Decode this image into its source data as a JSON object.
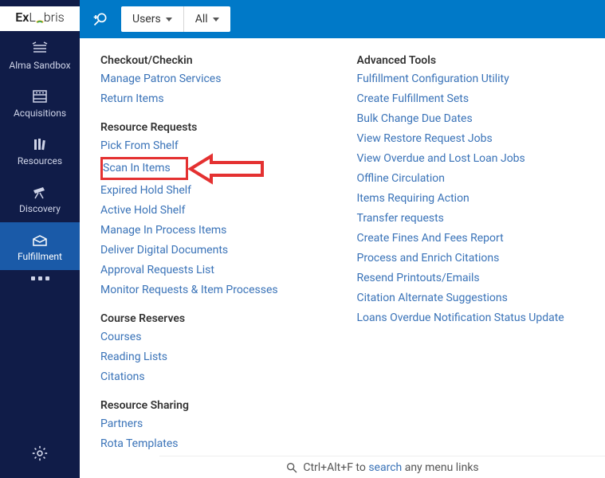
{
  "brand": {
    "name": "ExLibris"
  },
  "topbar": {
    "scope1": "Users",
    "scope2": "All"
  },
  "nav": {
    "items": [
      {
        "label": "Alma Sandbox"
      },
      {
        "label": "Acquisitions"
      },
      {
        "label": "Resources"
      },
      {
        "label": "Discovery"
      },
      {
        "label": "Fulfillment"
      }
    ]
  },
  "menu": {
    "left": [
      {
        "header": "Checkout/Checkin",
        "links": [
          "Manage Patron Services",
          "Return Items"
        ]
      },
      {
        "header": "Resource Requests",
        "links": [
          "Pick From Shelf",
          "Scan In Items",
          "Expired Hold Shelf",
          "Active Hold Shelf",
          "Manage In Process Items",
          "Deliver Digital Documents",
          "Approval Requests List",
          "Monitor Requests & Item Processes"
        ]
      },
      {
        "header": "Course Reserves",
        "links": [
          "Courses",
          "Reading Lists",
          "Citations"
        ]
      },
      {
        "header": "Resource Sharing",
        "links": [
          "Partners",
          "Rota Templates"
        ]
      }
    ],
    "right": [
      {
        "header": "Advanced Tools",
        "links": [
          "Fulfillment Configuration Utility",
          "Create Fulfillment Sets",
          "Bulk Change Due Dates",
          "View Restore Request Jobs",
          "View Overdue and Lost Loan Jobs",
          "Offline Circulation",
          "Items Requiring Action",
          "Transfer requests",
          "Create Fines And Fees Report",
          "Process and Enrich Citations",
          "Resend Printouts/Emails",
          "Citation Alternate Suggestions",
          "Loans Overdue Notification Status Update"
        ]
      }
    ]
  },
  "footer": {
    "prefix": "Ctrl+Alt+F to ",
    "link": "search",
    "suffix": " any menu links"
  },
  "highlight_target": "Scan In Items",
  "colors": {
    "accent": "#0079c8",
    "sidebar": "#101c48",
    "link": "#3a73b8",
    "highlight": "#e43131"
  }
}
